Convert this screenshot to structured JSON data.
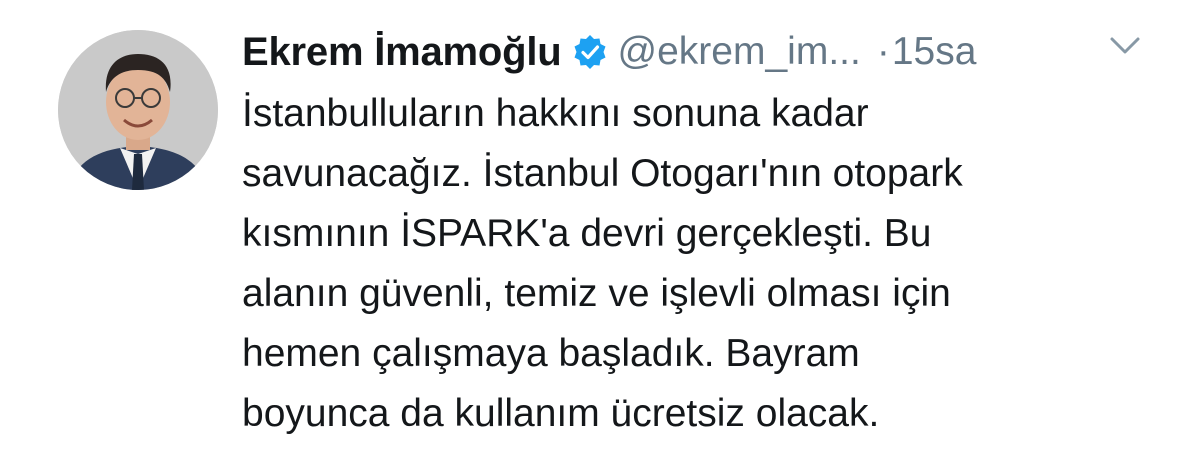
{
  "tweet": {
    "author_name": "Ekrem İmamoğlu",
    "handle": "@ekrem_im...",
    "separator": "·",
    "timestamp": "15sa",
    "verified_icon": "verified-badge-icon",
    "menu_icon": "chevron-down-icon",
    "avatar_icon": "profile-photo",
    "text_lines": [
      "İstanbulluların hakkını sonuna kadar",
      "savunacağız. İstanbul Otogarı'nın otopark",
      "kısmının İSPARK'a devri gerçekleşti. Bu",
      "alanın güvenli, temiz ve işlevli olması için",
      "hemen çalışmaya başladık. Bayram",
      "boyunca da kullanım ücretsiz olacak."
    ]
  },
  "colors": {
    "text": "#14171a",
    "secondary": "#657786",
    "verified": "#1da1f2",
    "background": "#ffffff"
  }
}
